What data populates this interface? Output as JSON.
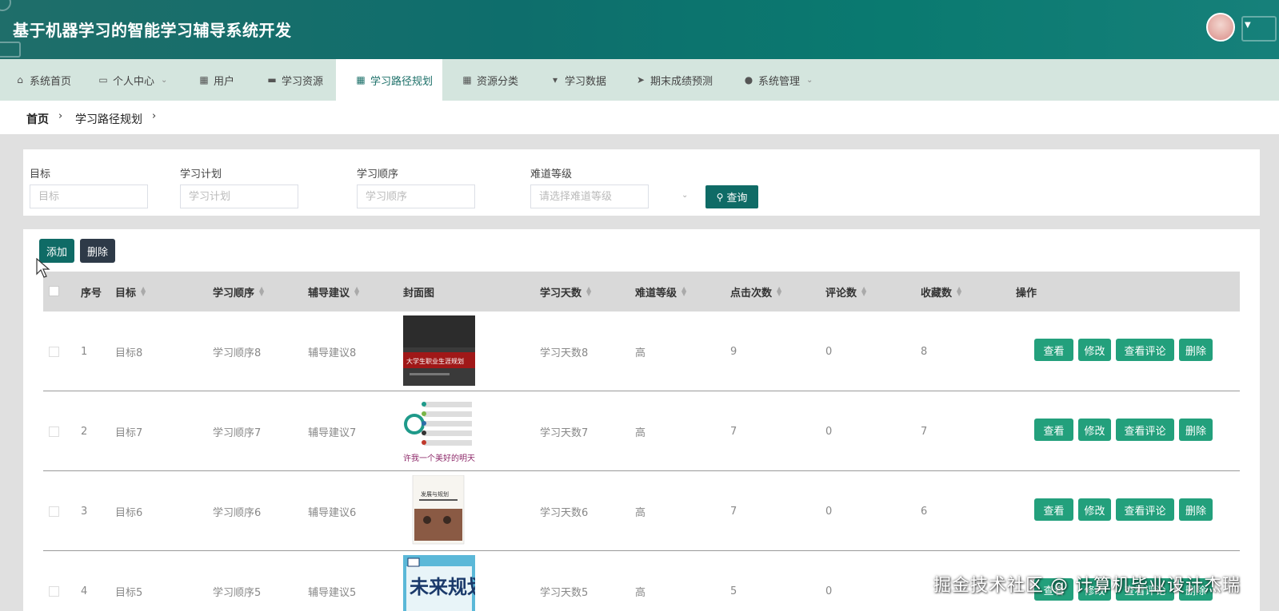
{
  "header": {
    "title": "基于机器学习的智能学习辅导系统开发"
  },
  "nav": {
    "items": [
      {
        "label": "系统首页",
        "icon": "home-icon"
      },
      {
        "label": "个人中心",
        "icon": "user-card-icon"
      },
      {
        "label": "用户",
        "icon": "grid-icon"
      },
      {
        "label": "学习资源",
        "icon": "printer-icon"
      },
      {
        "label": "学习路径规划",
        "icon": "grid-icon"
      },
      {
        "label": "资源分类",
        "icon": "grid-icon"
      },
      {
        "label": "学习数据",
        "icon": "trophy-icon"
      },
      {
        "label": "期末成绩预测",
        "icon": "send-icon"
      },
      {
        "label": "系统管理",
        "icon": "person-icon"
      }
    ],
    "active": "学习路径规划"
  },
  "breadcrumb": {
    "home": "首页",
    "current": "学习路径规划"
  },
  "search": {
    "fields": [
      {
        "label": "目标",
        "placeholder": "目标"
      },
      {
        "label": "学习计划",
        "placeholder": "学习计划"
      },
      {
        "label": "学习顺序",
        "placeholder": "学习顺序"
      },
      {
        "label": "难道等级",
        "placeholder": "请选择难道等级"
      }
    ],
    "button_label": "查询"
  },
  "actions": {
    "add_label": "添加",
    "delete_label": "删除"
  },
  "table": {
    "headers": [
      "序号",
      "目标",
      "学习顺序",
      "辅导建议",
      "封面图",
      "学习天数",
      "难道等级",
      "点击次数",
      "评论数",
      "收藏数",
      "操作"
    ],
    "rows": [
      {
        "index": "1",
        "goal": "目标8",
        "order": "学习顺序8",
        "advice": "辅导建议8",
        "days": "学习天数8",
        "level": "高",
        "clicks": "9",
        "comments": "0",
        "favorites": "8",
        "cover_text": "大学生职业生涯规划"
      },
      {
        "index": "2",
        "goal": "目标7",
        "order": "学习顺序7",
        "advice": "辅导建议7",
        "days": "学习天数7",
        "level": "高",
        "clicks": "7",
        "comments": "0",
        "favorites": "7",
        "cover_text": "许我一个美好的明天"
      },
      {
        "index": "3",
        "goal": "目标6",
        "order": "学习顺序6",
        "advice": "辅导建议6",
        "days": "学习天数6",
        "level": "高",
        "clicks": "7",
        "comments": "0",
        "favorites": "6",
        "cover_text": "发展与规划"
      },
      {
        "index": "4",
        "goal": "目标5",
        "order": "学习顺序5",
        "advice": "辅导建议5",
        "days": "学习天数5",
        "level": "高",
        "clicks": "5",
        "comments": "0",
        "favorites": "",
        "cover_text": "未来规划"
      }
    ],
    "row_actions": [
      "查看",
      "修改",
      "查看评论",
      "删除"
    ]
  },
  "watermark": "掘金技术社区 @ 计算机毕业设计杰瑞",
  "colors": {
    "header": "#0e6e6c",
    "nav_bg": "#d4e5de",
    "primary_button": "#0f6b66",
    "delete_button": "#2e3a48",
    "row_action": "#23a07c"
  }
}
